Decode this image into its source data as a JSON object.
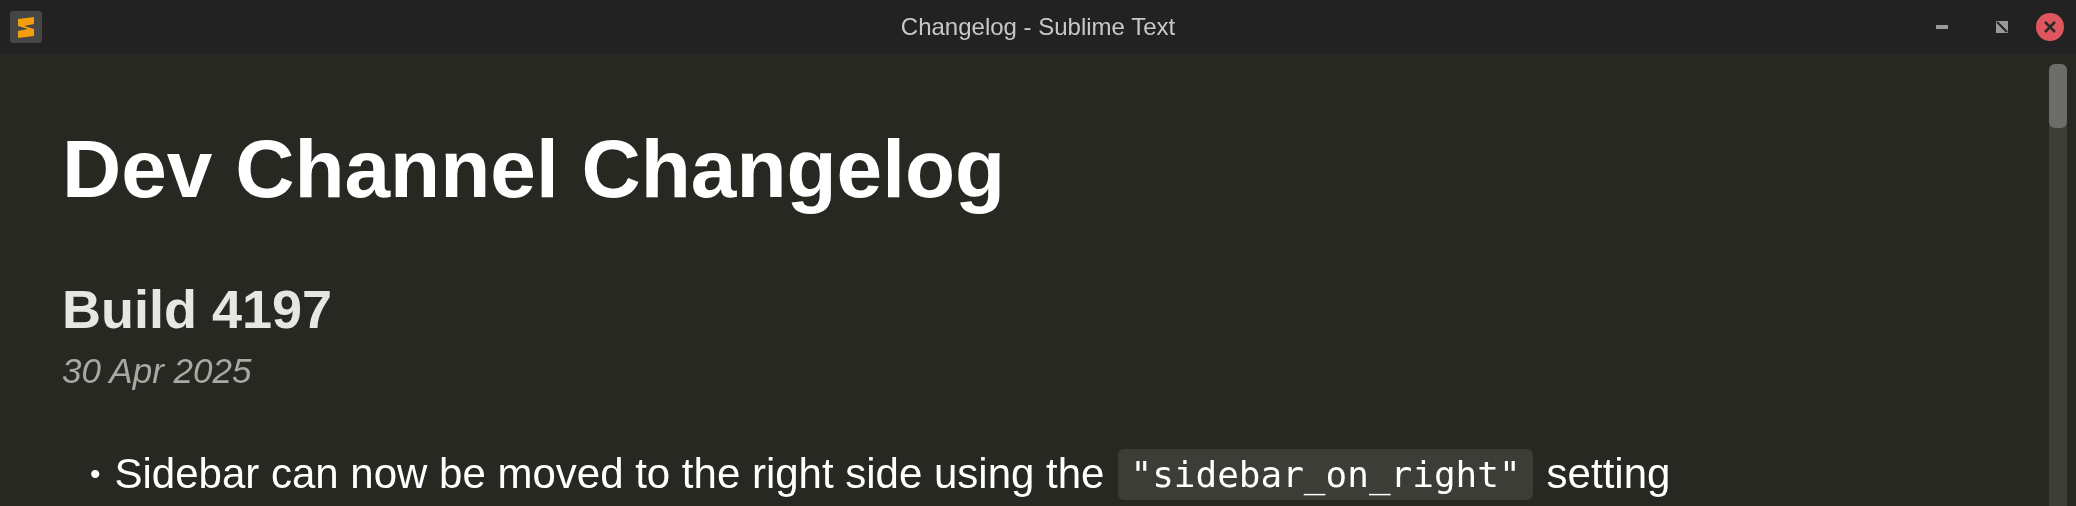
{
  "window": {
    "title": "Changelog - Sublime Text"
  },
  "document": {
    "heading": "Dev Channel Changelog",
    "builds": [
      {
        "title": "Build 4197",
        "date": "30 Apr 2025",
        "items": [
          {
            "bullet": "•",
            "parts": [
              {
                "kind": "text",
                "text": "Sidebar can now be moved to the right side using the"
              },
              {
                "kind": "code",
                "text": "\"sidebar_on_right\""
              },
              {
                "kind": "text",
                "text": "setting"
              }
            ]
          }
        ]
      }
    ]
  }
}
